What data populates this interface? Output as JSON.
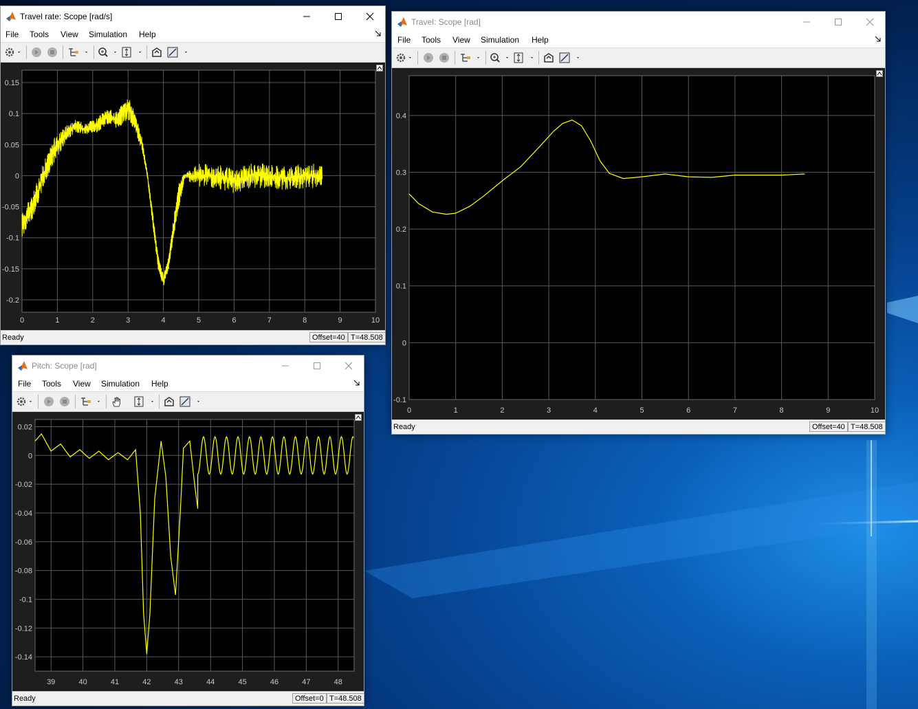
{
  "colors": {
    "trace": "#ffff00",
    "plot_bg": "#000000",
    "grid": "#5a5a5a",
    "frame_bg": "#1e1e1e"
  },
  "menu": [
    "File",
    "Tools",
    "View",
    "Simulation",
    "Help"
  ],
  "icons": [
    "matlab-logo-icon",
    "minimize-icon",
    "maximize-icon",
    "close-icon",
    "settings-gear-icon",
    "run-icon",
    "stop-icon",
    "signal-select-icon",
    "zoom-in-icon",
    "pan-hand-icon",
    "autoscale-icon",
    "restore-axes-icon",
    "measurement-icon",
    "undock-icon"
  ],
  "windows": {
    "travel_rate": {
      "title": "Travel rate: Scope [rad/s]",
      "status": "Ready",
      "offset": "Offset=40",
      "time": "T=48.508"
    },
    "travel": {
      "title": "Travel: Scope [rad]",
      "status": "Ready",
      "offset": "Offset=40",
      "time": "T=48.508"
    },
    "pitch": {
      "title": "Pitch: Scope [rad]",
      "status": "Ready",
      "offset": "Offset=0",
      "time": "T=48.508"
    }
  },
  "chart_data": [
    {
      "type": "line",
      "window": "travel_rate",
      "xlim": [
        0,
        10
      ],
      "ylim": [
        -0.22,
        0.17
      ],
      "xticks": [
        0,
        1,
        2,
        3,
        4,
        5,
        6,
        7,
        8,
        9,
        10
      ],
      "yticks": [
        -0.2,
        -0.15,
        -0.1,
        -0.05,
        0,
        0.05,
        0.1,
        0.15
      ],
      "ytick_labels": [
        "-0.2",
        "-0.15",
        "-0.1",
        "-0.05",
        "0",
        "0.05",
        "0.1",
        "0.15"
      ],
      "grid": true,
      "series": [
        {
          "x": [
            0,
            0.3,
            0.6,
            0.9,
            1.2,
            1.5,
            1.8,
            2.1,
            2.4,
            2.7,
            3.0,
            3.2,
            3.4,
            3.55,
            3.7,
            3.85,
            4.0,
            4.15,
            4.3,
            4.45,
            4.6,
            5.0,
            5.5,
            6.0,
            6.5,
            7.0,
            7.5,
            8.0,
            8.5
          ],
          "y": [
            -0.08,
            -0.05,
            0.0,
            0.04,
            0.065,
            0.08,
            0.075,
            0.08,
            0.095,
            0.09,
            0.11,
            0.085,
            0.05,
            0.0,
            -0.07,
            -0.14,
            -0.17,
            -0.14,
            -0.08,
            -0.03,
            0.0,
            0.0,
            0.0,
            -0.01,
            0.0,
            0.0,
            -0.005,
            0.0,
            0.0
          ],
          "noise": [
            0.02,
            0.02,
            0.02,
            0.02,
            0.015,
            0.01,
            0.01,
            0.012,
            0.012,
            0.015,
            0.02,
            0.015,
            0.01,
            0.005,
            0.01,
            0.012,
            0.01,
            0.01,
            0.015,
            0.02,
            0.005,
            0.02,
            0.02,
            0.02,
            0.02,
            0.02,
            0.02,
            0.02,
            0.02
          ]
        }
      ]
    },
    {
      "type": "line",
      "window": "travel",
      "xlim": [
        0,
        10
      ],
      "ylim": [
        -0.1,
        0.47
      ],
      "xticks": [
        0,
        1,
        2,
        3,
        4,
        5,
        6,
        7,
        8,
        9,
        10
      ],
      "yticks": [
        -0.1,
        0,
        0.1,
        0.2,
        0.3,
        0.4
      ],
      "ytick_labels": [
        "-0.1",
        "0",
        "0.1",
        "0.2",
        "0.3",
        "0.4"
      ],
      "grid": true,
      "series": [
        {
          "x": [
            0,
            0.2,
            0.5,
            0.8,
            1.0,
            1.3,
            1.6,
            2.0,
            2.4,
            2.8,
            3.1,
            3.3,
            3.5,
            3.7,
            3.9,
            4.1,
            4.3,
            4.6,
            5.0,
            5.5,
            6.0,
            6.5,
            7.0,
            7.5,
            8.0,
            8.5
          ],
          "y": [
            0.262,
            0.245,
            0.23,
            0.226,
            0.228,
            0.24,
            0.258,
            0.285,
            0.31,
            0.345,
            0.372,
            0.386,
            0.392,
            0.382,
            0.355,
            0.32,
            0.298,
            0.289,
            0.292,
            0.297,
            0.292,
            0.291,
            0.295,
            0.295,
            0.295,
            0.297
          ]
        }
      ]
    },
    {
      "type": "line",
      "window": "pitch",
      "xlim": [
        38.5,
        48.5
      ],
      "ylim": [
        -0.15,
        0.025
      ],
      "xticks": [
        39,
        40,
        41,
        42,
        43,
        44,
        45,
        46,
        47,
        48
      ],
      "yticks": [
        -0.14,
        -0.12,
        -0.1,
        -0.08,
        -0.06,
        -0.04,
        -0.02,
        0,
        0.02
      ],
      "ytick_labels": [
        "-0.14",
        "-0.12",
        "-0.1",
        "-0.08",
        "-0.06",
        "-0.04",
        "-0.02",
        "0",
        "0.02"
      ],
      "grid": true,
      "series": [
        {
          "x": [
            38.5,
            38.7,
            39.0,
            39.3,
            39.6,
            39.9,
            40.2,
            40.5,
            40.8,
            41.1,
            41.4,
            41.65,
            41.8,
            41.9,
            42.0,
            42.1,
            42.25,
            42.45,
            42.6,
            42.75,
            42.9,
            43.05,
            43.15,
            43.35,
            43.5,
            43.6
          ],
          "y": [
            0.01,
            0.015,
            0.003,
            0.008,
            -0.001,
            0.004,
            -0.002,
            0.003,
            -0.003,
            0.002,
            -0.003,
            0.004,
            -0.04,
            -0.11,
            -0.138,
            -0.11,
            -0.03,
            0.01,
            -0.015,
            -0.07,
            -0.097,
            -0.04,
            0.005,
            0.01,
            -0.02,
            -0.037
          ]
        }
      ],
      "oscillation": {
        "x_start": 43.6,
        "x_end": 48.5,
        "center": 0.0,
        "amplitude": 0.013,
        "period": 0.36
      }
    }
  ]
}
